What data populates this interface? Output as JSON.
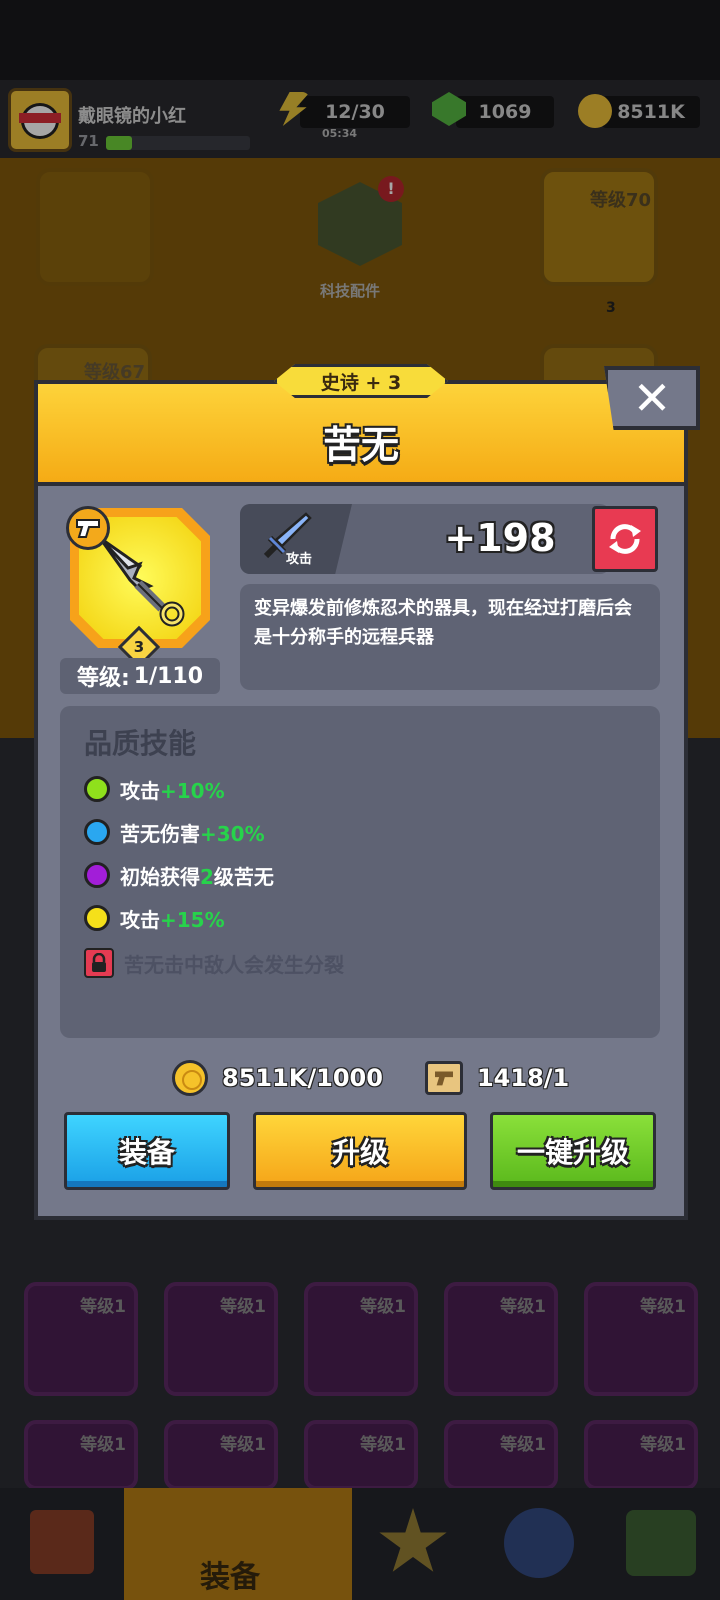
{
  "hud": {
    "player_name": "戴眼镜的小红",
    "player_level": "71",
    "energy": "12/30",
    "energy_timer": "05:34",
    "gems": "1069",
    "gold": "8511K"
  },
  "background": {
    "tech_label": "科技配件",
    "slot_top_right_level": "等级70",
    "slot_top_right_stars": "3",
    "slot_left_partial": "等级67",
    "lower_slots": [
      "等级1",
      "等级1",
      "等级1",
      "等级1",
      "等级1",
      "等级1",
      "等级1",
      "等级1",
      "等级1",
      "等级1"
    ],
    "nav_active_label": "装备"
  },
  "modal": {
    "rarity": "史诗 + 3",
    "title": "苦无",
    "close_symbol": "✕",
    "item_stars": "3",
    "level_label": "等级:",
    "level_value": "1/110",
    "attack_label": "攻击",
    "attack_value": "+198",
    "description": "变异爆发前修炼忍术的器具，现在经过打磨后会是十分称手的远程兵器",
    "skills_title": "品质技能",
    "skills": [
      {
        "text": "攻击",
        "highlight": "+10%",
        "suffix": "",
        "color": "#8fe01c"
      },
      {
        "text": "苦无伤害",
        "highlight": "+30%",
        "suffix": "",
        "color": "#2aa7f0"
      },
      {
        "text": "初始获得",
        "highlight": "2",
        "suffix": "级苦无",
        "color": "#a21ed8"
      },
      {
        "text": "攻击",
        "highlight": "+15%",
        "suffix": "",
        "color": "#f5e01a"
      }
    ],
    "locked_skill": "苦无击中敌人会发生分裂",
    "cost_gold": "8511K/1000",
    "cost_scroll": "1418/1",
    "btn_equip": "装备",
    "btn_upgrade": "升级",
    "btn_oneclick": "一键升级"
  },
  "colors": {
    "header_yellow": "#f5ab15",
    "panel_gray": "#74788a",
    "accent_green": "#27d34b",
    "refresh_red": "#e83a52"
  }
}
